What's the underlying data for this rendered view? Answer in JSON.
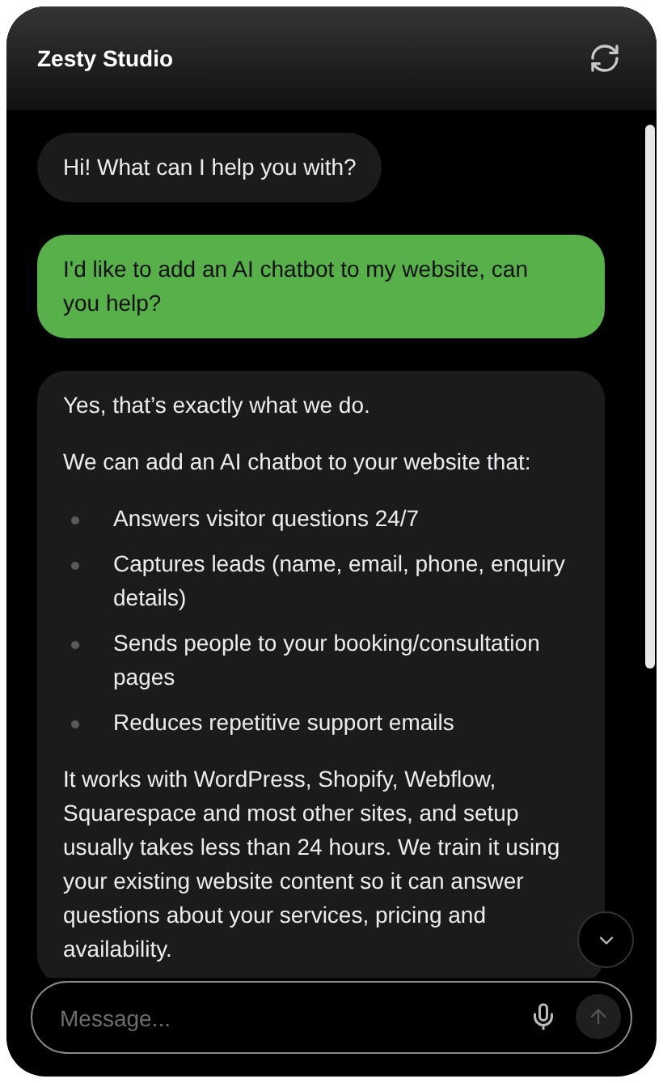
{
  "header": {
    "title": "Zesty Studio"
  },
  "messages": [
    {
      "kind": "bot",
      "blocks": [
        {
          "kind": "text",
          "text": "Hi! What can I help you with?"
        }
      ]
    },
    {
      "kind": "user",
      "blocks": [
        {
          "kind": "text",
          "text": "I'd like to add an AI chatbot to my website, can you help?"
        }
      ]
    },
    {
      "kind": "bot",
      "blocks": [
        {
          "kind": "text",
          "text": "Yes, that’s exactly what we do."
        },
        {
          "kind": "text",
          "text": "We can add an AI chatbot to your website that:"
        },
        {
          "kind": "list",
          "items": [
            "Answers visitor questions 24/7",
            "Captures leads (name, email, phone, enquiry details)",
            "Sends people to your booking/consultation pages",
            "Reduces repetitive support emails"
          ]
        },
        {
          "kind": "text",
          "text": "It works with WordPress, Shopify, Webflow, Squarespace and most other sites, and setup usually takes less than 24 hours. We train it using your existing website content so it can answer questions about your services, pricing and availability."
        }
      ]
    }
  ],
  "composer": {
    "placeholder": "Message..."
  }
}
